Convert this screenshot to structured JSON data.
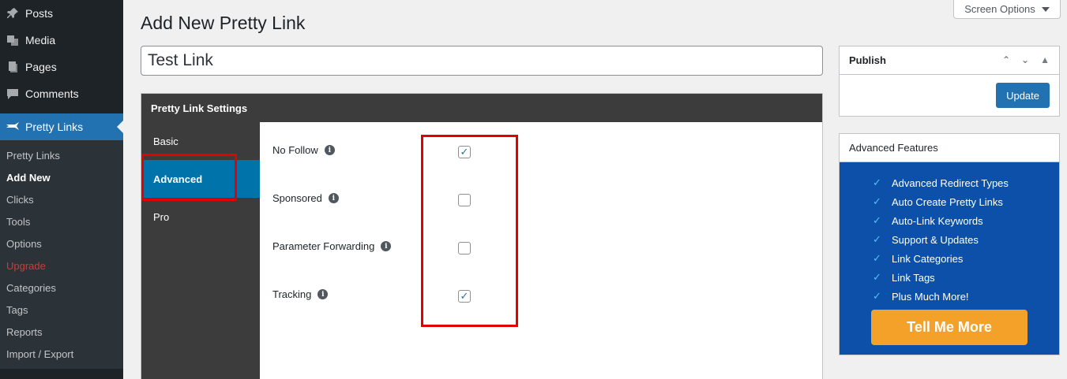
{
  "sidebar": {
    "menu": [
      {
        "label": "Posts",
        "icon": "pin-icon"
      },
      {
        "label": "Media",
        "icon": "media-icon"
      },
      {
        "label": "Pages",
        "icon": "pages-icon"
      },
      {
        "label": "Comments",
        "icon": "comments-icon"
      }
    ],
    "current": {
      "label": "Pretty Links",
      "icon": "pretty-links-icon"
    },
    "submenu": [
      "Pretty Links",
      "Add New",
      "Clicks",
      "Tools",
      "Options",
      "Upgrade",
      "Categories",
      "Tags",
      "Reports",
      "Import / Export"
    ],
    "active_submenu": "Add New"
  },
  "header": {
    "screen_options": "Screen Options",
    "page_title": "Add New Pretty Link"
  },
  "title_input": {
    "value": "Test Link"
  },
  "settings": {
    "header": "Pretty Link Settings",
    "tabs": [
      "Basic",
      "Advanced",
      "Pro"
    ],
    "active_tab": "Advanced",
    "fields": [
      {
        "label": "No Follow",
        "checked": true
      },
      {
        "label": "Sponsored",
        "checked": false
      },
      {
        "label": "Parameter Forwarding",
        "checked": false
      },
      {
        "label": "Tracking",
        "checked": true
      }
    ]
  },
  "publish": {
    "title": "Publish",
    "update_label": "Update"
  },
  "advanced_features": {
    "title": "Advanced Features",
    "items": [
      "Advanced Redirect Types",
      "Auto Create Pretty Links",
      "Auto-Link Keywords",
      "Support & Updates",
      "Link Categories",
      "Link Tags",
      "Plus Much More!"
    ],
    "cta": "Tell Me More"
  },
  "colors": {
    "sidebar_bg": "#1d2327",
    "current_menu": "#2271b1",
    "active_tab": "#0073aa",
    "highlight": "#e30000",
    "promo_bg": "#0c50a9",
    "cta_bg": "#f4a12a"
  }
}
